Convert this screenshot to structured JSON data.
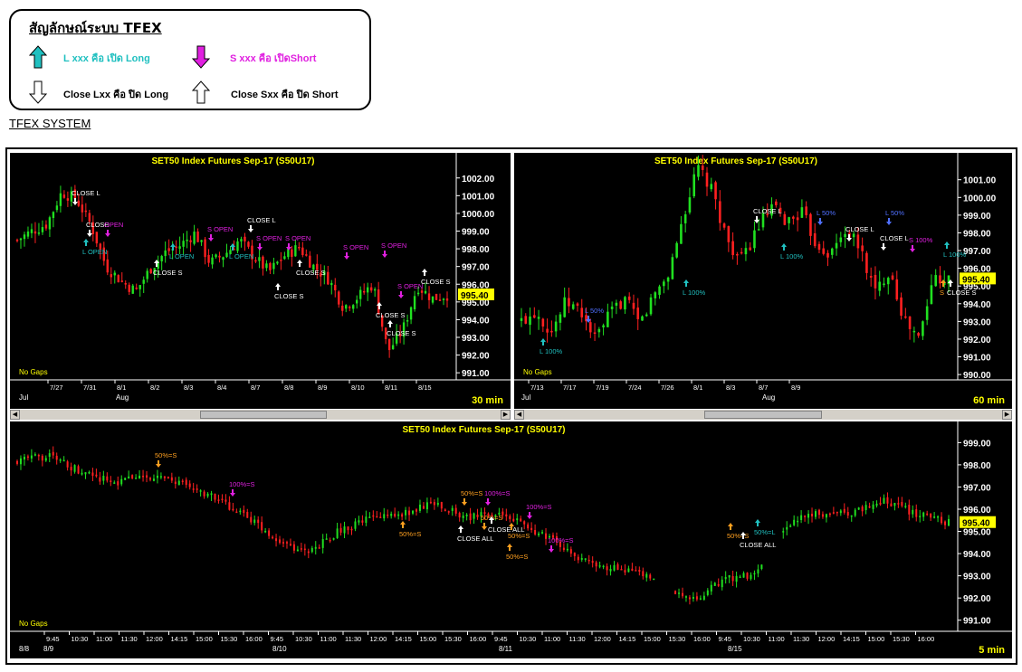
{
  "legend": {
    "title": "สัญลักษณ์ระบบ TFEX",
    "open_long": "L xxx คือ เปิด Long",
    "open_short": "S xxx คือ เปิดShort",
    "close_long": "Close Lxx คือ ปิด Long",
    "close_short": "Close Sxx คือ ปิด Short",
    "colors": {
      "long": "#20c0c0",
      "short": "#e020e0",
      "close": "#ffffff"
    }
  },
  "system_title": "TFEX SYSTEM",
  "panels": {
    "p30": {
      "title": "SET50  Index  Futures  Sep-17  (S50U17)",
      "timeframe": "30  min",
      "nogaps": "No Gaps",
      "price": "995.40",
      "yticks": [
        "1002.00",
        "1001.00",
        "1000.00",
        "999.00",
        "998.00",
        "997.00",
        "996.00",
        "995.00",
        "994.00",
        "993.00",
        "992.00",
        "991.00"
      ],
      "xdates": [
        "7/27",
        "7/31",
        "8/1",
        "8/2",
        "8/3",
        "8/4",
        "8/7",
        "8/8",
        "8/9",
        "8/10",
        "8/11",
        "8/15"
      ],
      "months": [
        "Jul",
        "Aug"
      ],
      "signals": [
        {
          "label": "CLOSE  L",
          "color": "#ffffff",
          "dir": "down"
        },
        {
          "label": "CLOSE",
          "color": "#ffffff",
          "dir": "down"
        },
        {
          "label": "OPEN",
          "color": "#e020e0",
          "dir": "down"
        },
        {
          "label": "L OPEN",
          "color": "#20c0c0",
          "dir": "up"
        },
        {
          "label": "L  OPEN",
          "color": "#20c0c0",
          "dir": "up"
        },
        {
          "label": "S  OPEN",
          "color": "#e020e0",
          "dir": "down"
        },
        {
          "label": "CLOSE  L",
          "color": "#ffffff",
          "dir": "down"
        },
        {
          "label": "L  OPEN",
          "color": "#20c0c0",
          "dir": "up"
        },
        {
          "label": "S  OPEN",
          "color": "#e020e0",
          "dir": "down"
        },
        {
          "label": "S  OPEN",
          "color": "#e020e0",
          "dir": "down"
        },
        {
          "label": "CLOSE  S",
          "color": "#ffffff",
          "dir": "up"
        },
        {
          "label": "CLOSE  S",
          "color": "#ffffff",
          "dir": "up"
        },
        {
          "label": "CLOSE  S",
          "color": "#ffffff",
          "dir": "up"
        },
        {
          "label": "S  OPEN",
          "color": "#e020e0",
          "dir": "down"
        },
        {
          "label": "S  OPEN",
          "color": "#e020e0",
          "dir": "down"
        },
        {
          "label": "S  OPEN",
          "color": "#e020e0",
          "dir": "down"
        },
        {
          "label": "CLOSE  S",
          "color": "#ffffff",
          "dir": "up"
        },
        {
          "label": "CLOSE  S",
          "color": "#ffffff",
          "dir": "up"
        },
        {
          "label": "CLOSE  S",
          "color": "#ffffff",
          "dir": "up"
        }
      ]
    },
    "p60": {
      "title": "SET50  Index  Futures  Sep-17  (S50U17)",
      "timeframe": "60  min",
      "nogaps": "No Gaps",
      "price": "995.40",
      "yticks": [
        "1001.00",
        "1000.00",
        "999.00",
        "998.00",
        "997.00",
        "996.00",
        "995.00",
        "994.00",
        "993.00",
        "992.00",
        "991.00",
        "990.00"
      ],
      "xdates": [
        "7/13",
        "7/17",
        "7/19",
        "7/24",
        "7/26",
        "8/1",
        "8/3",
        "8/7",
        "8/9"
      ],
      "months": [
        "Jul",
        "Aug"
      ],
      "signals": [
        {
          "label": "L  100%",
          "color": "#20c0c0",
          "dir": "up"
        },
        {
          "label": "L  50%",
          "color": "#5070ff",
          "dir": "down"
        },
        {
          "label": "L  100%",
          "color": "#20c0c0",
          "dir": "up"
        },
        {
          "label": "CLOSE  L",
          "color": "#ffffff",
          "dir": "down"
        },
        {
          "label": "L  100%",
          "color": "#20c0c0",
          "dir": "up"
        },
        {
          "label": "L  50%",
          "color": "#5070ff",
          "dir": "down"
        },
        {
          "label": "CLOSE  L",
          "color": "#ffffff",
          "dir": "down"
        },
        {
          "label": "L  50%",
          "color": "#5070ff",
          "dir": "down"
        },
        {
          "label": "CLOSE  L",
          "color": "#ffffff",
          "dir": "down"
        },
        {
          "label": "L  100%",
          "color": "#20c0c0",
          "dir": "up"
        },
        {
          "label": "S  100%",
          "color": "#e020e0",
          "dir": "down"
        },
        {
          "label": "S",
          "color": "#ffa020",
          "dir": "up"
        },
        {
          "label": "CLOSE  S",
          "color": "#ffffff",
          "dir": "up"
        }
      ]
    },
    "p5": {
      "title": "SET50  Index  Futures  Sep-17  (S50U17)",
      "timeframe": "5  min",
      "nogaps": "No Gaps",
      "price": "995.40",
      "yticks": [
        "999.00",
        "998.00",
        "997.00",
        "996.00",
        "995.00",
        "994.00",
        "993.00",
        "992.00",
        "991.00"
      ],
      "xtimes": [
        "9:45",
        "10:30",
        "11:00",
        "11:30",
        "12:00",
        "14:15",
        "15:00",
        "15:30",
        "16:00",
        "9:45",
        "10:30",
        "11:00",
        "11:30",
        "12:00",
        "14:15",
        "15:00",
        "15:30",
        "16:00",
        "9:45",
        "10:30",
        "11:00",
        "11:30",
        "12:00",
        "14:15",
        "15:00",
        "15:30",
        "16:00",
        "9:45",
        "10:30",
        "11:00",
        "11:30",
        "12:00",
        "14:15",
        "15:00",
        "15:30",
        "16:00"
      ],
      "days": [
        "8/8",
        "8/9",
        "8/10",
        "8/11",
        "8/15"
      ],
      "signals": [
        {
          "label": "50%=S",
          "color": "#ffa020",
          "dir": "down"
        },
        {
          "label": "100%=S",
          "color": "#e020e0",
          "dir": "down"
        },
        {
          "label": "50%=S",
          "color": "#ffa020",
          "dir": "up"
        },
        {
          "label": "50%=S",
          "color": "#ffa020",
          "dir": "down"
        },
        {
          "label": "100%=S",
          "color": "#e020e0",
          "dir": "down"
        },
        {
          "label": "50%=S",
          "color": "#ffa020",
          "dir": "down"
        },
        {
          "label": "50%=S",
          "color": "#ffa020",
          "dir": "up"
        },
        {
          "label": "CLOSE  ALL",
          "color": "#ffffff",
          "dir": "up"
        },
        {
          "label": "CLOSE  ALL",
          "color": "#ffffff",
          "dir": "up"
        },
        {
          "label": "100%=S",
          "color": "#e020e0",
          "dir": "down"
        },
        {
          "label": "50%=S",
          "color": "#ffa020",
          "dir": "up"
        },
        {
          "label": "100%=S",
          "color": "#e020e0",
          "dir": "down"
        },
        {
          "label": "50%=S",
          "color": "#ffa020",
          "dir": "up"
        },
        {
          "label": "CLOSE  ALL",
          "color": "#ffffff",
          "dir": "up"
        },
        {
          "label": "50%=L",
          "color": "#20c0c0",
          "dir": "up"
        }
      ]
    }
  },
  "chart_data": [
    {
      "type": "candlestick",
      "title": "SET50  Index  Futures  Sep-17  (S50U17)",
      "timeframe": "30  min",
      "ylim": [
        990.6,
        1002.6
      ],
      "close_path": [
        998.5,
        999.0,
        999.4,
        1001.2,
        1000.8,
        999.3,
        997.0,
        996.2,
        995.6,
        996.9,
        997.8,
        998.2,
        998.9,
        997.2,
        997.7,
        998.5,
        997.5,
        996.7,
        997.6,
        998.1,
        997.0,
        996.3,
        994.7,
        995.3,
        996.0,
        992.2,
        993.4,
        995.9,
        995.2,
        995.4
      ],
      "last_price": "995.40",
      "grid": false
    },
    {
      "type": "candlestick",
      "title": "SET50  Index  Futures  Sep-17  (S50U17)",
      "timeframe": "60  min",
      "ylim": [
        989.7,
        1001.7
      ],
      "close_path": [
        993.0,
        993.6,
        992.4,
        994.1,
        993.6,
        992.0,
        993.4,
        994.3,
        992.8,
        994.5,
        995.7,
        999.0,
        1001.7,
        1000.2,
        997.5,
        996.4,
        998.3,
        999.4,
        998.6,
        999.2,
        997.4,
        996.8,
        998.2,
        997.1,
        994.6,
        996.0,
        993.0,
        992.0,
        995.6,
        995.4
      ],
      "last_price": "995.40",
      "grid": false
    },
    {
      "type": "candlestick",
      "title": "SET50  Index  Futures  Sep-17  (S50U17)",
      "timeframe": "5  min",
      "ylim": [
        990.5,
        999.3
      ],
      "close_path": [
        998.2,
        998.4,
        997.7,
        997.2,
        997.5,
        997.2,
        996.6,
        995.8,
        994.7,
        994.0,
        995.0,
        995.6,
        995.8,
        996.3,
        995.6,
        995.9,
        995.1,
        994.3,
        993.4,
        993.3,
        992.7,
        991.9,
        992.8,
        993.1,
        995.4,
        995.8,
        995.8,
        996.4,
        995.8,
        995.4
      ],
      "last_price": "995.40",
      "grid": false
    }
  ]
}
